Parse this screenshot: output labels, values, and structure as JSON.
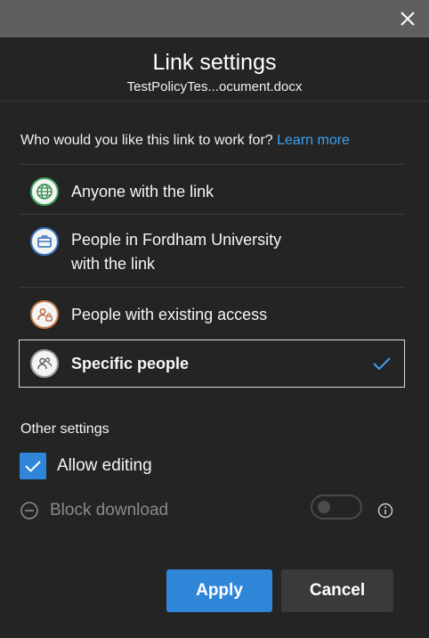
{
  "window": {
    "close_icon": "close-icon"
  },
  "dialog": {
    "title": "Link settings",
    "filename": "TestPolicyTes...ocument.docx",
    "question": "Who would you like this link to work for?",
    "learn_more": "Learn more"
  },
  "options": [
    {
      "line1": "Anyone with the link",
      "line2": "",
      "icon": "globe-icon",
      "selected": false
    },
    {
      "line1": "People in Fordham University",
      "line2": "with the link",
      "icon": "organization-icon",
      "selected": false
    },
    {
      "line1": "People with existing access",
      "line2": "",
      "icon": "people-lock-icon",
      "selected": false
    },
    {
      "line1": "Specific people",
      "line2": "",
      "icon": "specific-people-icon",
      "selected": true
    }
  ],
  "other_settings": {
    "heading": "Other settings",
    "allow_editing": {
      "label": "Allow editing",
      "checked": true
    },
    "block_download": {
      "label": "Block download",
      "enabled": false,
      "toggle_on": false
    }
  },
  "buttons": {
    "apply": "Apply",
    "cancel": "Cancel"
  },
  "colors": {
    "accent": "#2f86d8",
    "link": "#3fa0f0",
    "background": "#242424"
  }
}
